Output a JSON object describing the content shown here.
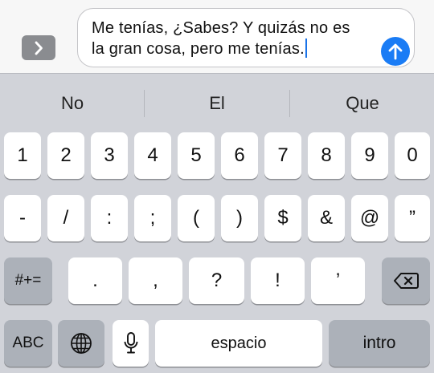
{
  "compose": {
    "message_lines": [
      "Me tenías, ¿Sabes? Y quizás no es",
      "la gran cosa, pero me tenías."
    ]
  },
  "suggestions": [
    "No",
    "El",
    "Que"
  ],
  "keyboard": {
    "row1": [
      "1",
      "2",
      "3",
      "4",
      "5",
      "6",
      "7",
      "8",
      "9",
      "0"
    ],
    "row2": [
      "-",
      "/",
      ":",
      ";",
      "(",
      ")",
      "$",
      "&",
      "@",
      "”"
    ],
    "row3": {
      "shift_label": "#+=",
      "keys": [
        ".",
        ",",
        "?",
        "!",
        "’"
      ]
    },
    "row4": {
      "abc_label": "ABC",
      "space_label": "espacio",
      "return_label": "intro"
    }
  },
  "icons": {
    "expand": "chevron-right-icon",
    "send": "arrow-up-icon",
    "delete": "backspace-icon",
    "globe": "globe-icon",
    "mic": "microphone-icon"
  },
  "colors": {
    "send_button": "#1a7cf5",
    "caret": "#1a73e8",
    "keyboard_bg": "#d1d3d9",
    "function_key": "#acb1b9"
  }
}
